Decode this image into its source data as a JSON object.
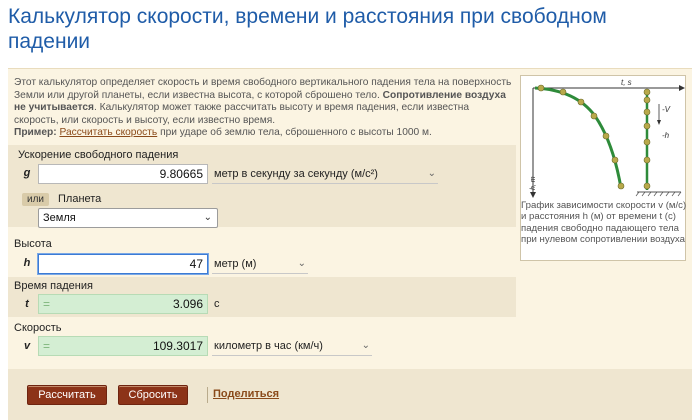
{
  "title": "Калькулятор скорости, времени и расстояния при свободном падении",
  "intro": {
    "line1": "Этот калькулятор определяет скорость и время свободного вертикального падения тела на поверхность Земли или другой планеты, если известна высота, с которой сброшено тело.",
    "bold": "Сопротивление воздуха не учитывается",
    "line2": ". Калькулятор может также рассчитать высоту и время падения, если известна скорость, или скорость и высоту, если известно время."
  },
  "example": {
    "label": "Пример:",
    "link": "Рассчитать скорость",
    "rest": "при ударе об землю тела, сброшенного с высоты 1000 м."
  },
  "gravity": {
    "label": "Ускорение свободного падения",
    "var": "g",
    "value": "9.80665",
    "unit": "метр в секунду за секунду (м/с²)"
  },
  "planet": {
    "or_label": "или",
    "label": "Планета",
    "selected": "Земля"
  },
  "height": {
    "label": "Высота",
    "var": "h",
    "value": "47",
    "unit": "метр (м)"
  },
  "time": {
    "label": "Время падения",
    "var": "t",
    "value": "3.096",
    "unit": "с"
  },
  "speed": {
    "label": "Скорость",
    "var": "v",
    "value": "109.3017",
    "unit": "километр в час (км/ч)"
  },
  "graph": {
    "axis_t": "t, s",
    "axis_h": "h, m",
    "label_v": "-V",
    "label_h": "-h",
    "caption": "График зависимости скорости v (м/с) и расстояния h (м) от времени t (с) падения свободно падающего тела при нулевом сопротивлении воздуха"
  },
  "buttons": {
    "calculate": "Рассчитать",
    "reset": "Сбросить",
    "share": "Поделиться"
  },
  "colors": {
    "title": "#1f5ca8",
    "button": "#8c3318",
    "result_bg": "#d4eed3",
    "curve": "#2e8b3a",
    "dot": "#b8a94a"
  }
}
